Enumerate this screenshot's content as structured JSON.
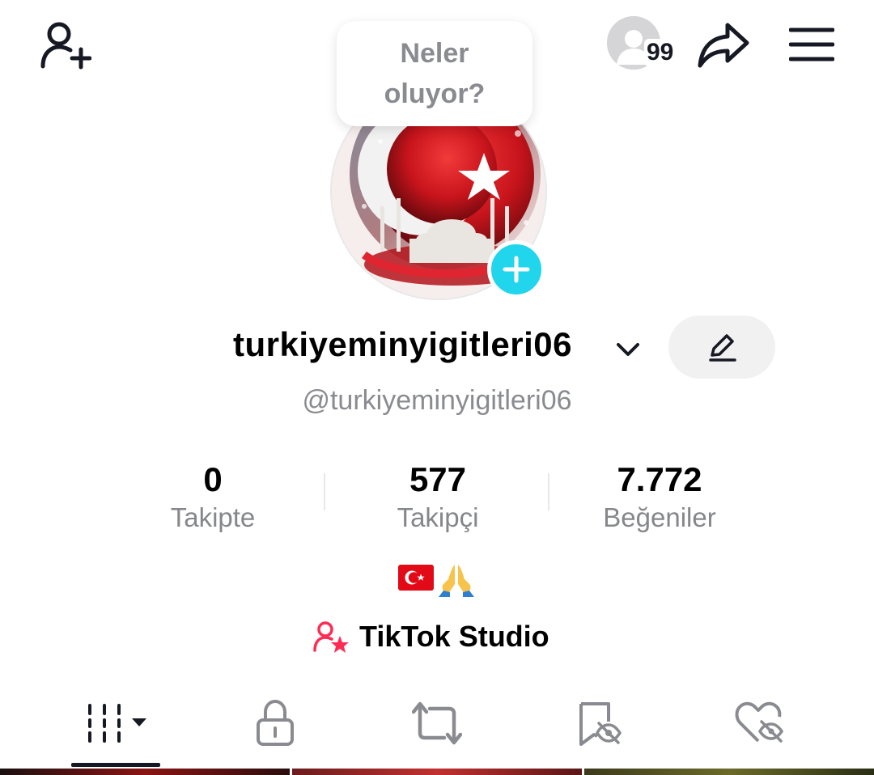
{
  "header": {
    "story_count": "99",
    "status_bubble": "Neler oluyor?"
  },
  "profile": {
    "display_name": "turkiyeminyigitleri06",
    "handle": "@turkiyeminyigitleri06",
    "bio": "🇹🇷🙏"
  },
  "stats": [
    {
      "value": "0",
      "label": "Takipte"
    },
    {
      "value": "577",
      "label": "Takipçi"
    },
    {
      "value": "7.772",
      "label": "Beğeniler"
    }
  ],
  "studio": {
    "label": "TikTok Studio"
  },
  "tabs": [
    {
      "icon": "videos-grid-icon",
      "active": true
    },
    {
      "icon": "lock-icon"
    },
    {
      "icon": "repost-icon"
    },
    {
      "icon": "favorites-icon"
    },
    {
      "icon": "liked-hidden-icon"
    }
  ],
  "colors": {
    "accent_cyan": "#20d5ec",
    "studio_pink": "#fe2c55",
    "text_primary": "#161823",
    "text_secondary": "#8a8b91"
  }
}
